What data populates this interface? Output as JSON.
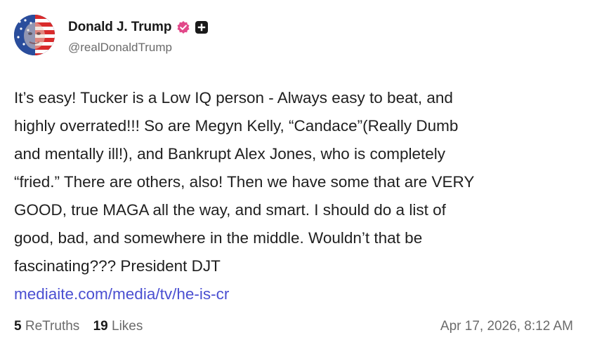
{
  "author": {
    "display_name": "Donald J. Trump",
    "handle": "@realDonaldTrump",
    "verified_icon": "verified-badge-icon",
    "plus_icon": "plus-badge-icon",
    "avatar_icon": "flag-face-avatar"
  },
  "post": {
    "lines": [
      "It’s easy! Tucker is a Low IQ person - Always easy to beat, and",
      "highly overrated!!! So are Megyn Kelly, “Candace”(Really Dumb",
      "and mentally ill!), and Bankrupt Alex Jones, who is completely",
      "“fried.” There are others, also! Then we have some that are VERY",
      "GOOD, true MAGA all the way, and smart. I should do a list of",
      "good, bad, and somewhere in the middle. Wouldn’t that be",
      "fascinating??? President DJT"
    ],
    "link": "mediaite.com/media/tv/he-is-cr"
  },
  "stats": {
    "retruths_count": "5",
    "retruths_label": "ReTruths",
    "likes_count": "19",
    "likes_label": "Likes"
  },
  "timestamp": "Apr 17, 2026, 8:12 AM",
  "colors": {
    "link": "#4a4fd1",
    "verified_badge": "#e2498a",
    "text_primary": "#1f1f1f",
    "text_secondary": "#6b6b6b"
  }
}
